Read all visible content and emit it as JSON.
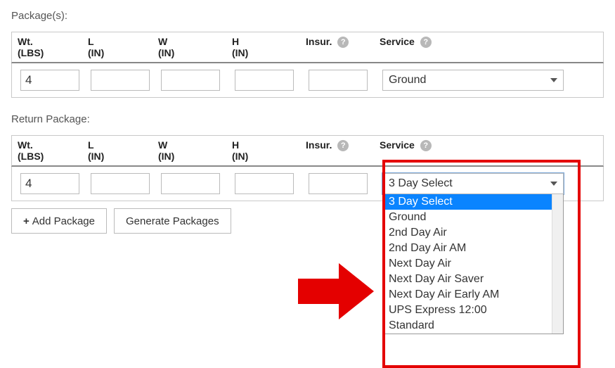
{
  "sections": {
    "packages_label": "Package(s):",
    "return_label": "Return Package:"
  },
  "headers": {
    "wt_top": "Wt.",
    "wt_sub": "(LBS)",
    "l_top": "L",
    "l_sub": "(IN)",
    "w_top": "W",
    "w_sub": "(IN)",
    "h_top": "H",
    "h_sub": "(IN)",
    "insur": "Insur.",
    "service": "Service"
  },
  "package_row": {
    "wt": "4",
    "l": "",
    "w": "",
    "h": "",
    "insur": "",
    "service": "Ground"
  },
  "return_row": {
    "wt": "4",
    "l": "",
    "w": "",
    "h": "",
    "insur": "",
    "service": "3 Day Select"
  },
  "service_options": [
    "3 Day Select",
    "Ground",
    "2nd Day Air",
    "2nd Day Air AM",
    "Next Day Air",
    "Next Day Air Saver",
    "Next Day Air Early AM",
    "UPS Express 12:00",
    "Standard"
  ],
  "buttons": {
    "add_package": "Add Package",
    "generate_packages": "Generate Packages"
  }
}
